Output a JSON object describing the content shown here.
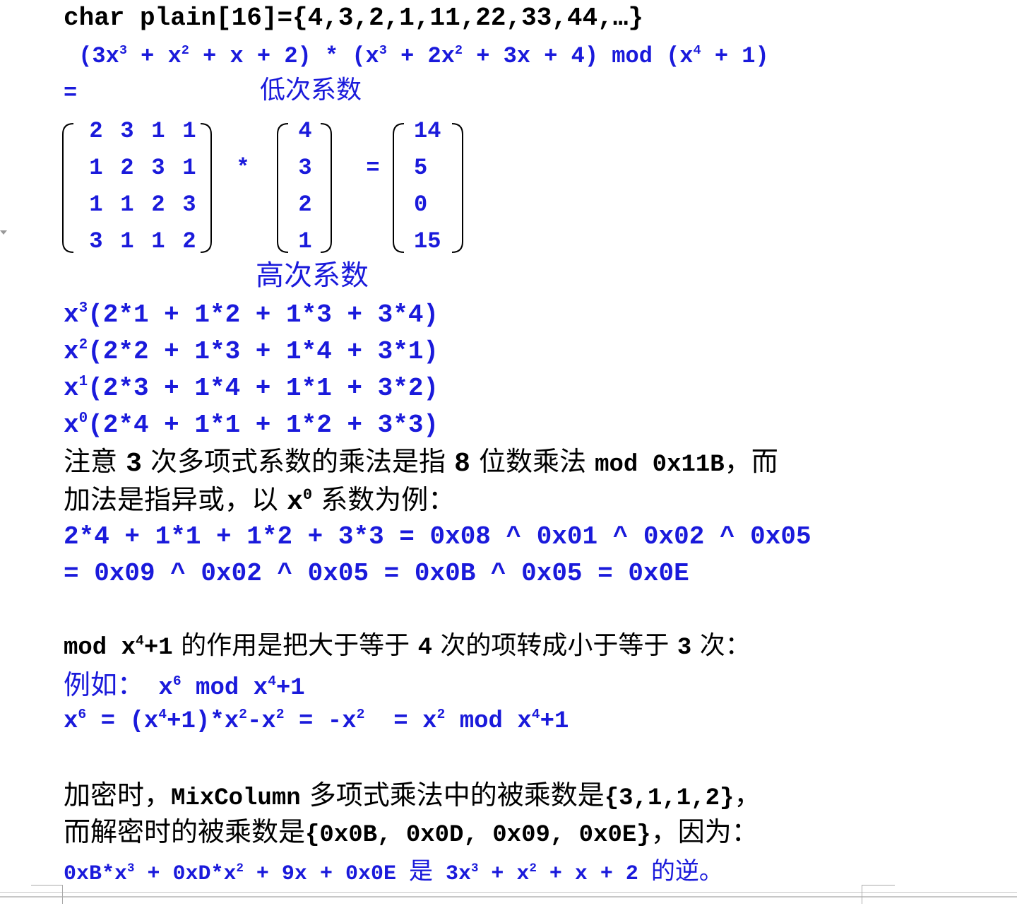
{
  "line1": "char plain[16]={4,3,2,1,11,22,33,44,…}",
  "line2": {
    "p1": " (3x",
    "e1": "3",
    "p2": " + x",
    "e2": "2",
    "p3": " + x + 2) * (x",
    "e3": "3",
    "p4": " + 2x",
    "e4": "2",
    "p5": " + 3x + 4) mod (x",
    "e5": "4",
    "p6": " + 1)"
  },
  "eq_sign": "=",
  "low_coeff_label": "低次系数",
  "high_coeff_label": "高次系数",
  "matrix": {
    "rows": [
      [
        "2",
        "3",
        "1",
        "1"
      ],
      [
        "1",
        "2",
        "3",
        "1"
      ],
      [
        "1",
        "1",
        "2",
        "3"
      ],
      [
        "3",
        "1",
        "1",
        "2"
      ]
    ],
    "times": "*",
    "vector": [
      "4",
      "3",
      "2",
      "1"
    ],
    "equals": "=",
    "result": [
      "14",
      "5",
      "0",
      "15"
    ]
  },
  "terms": [
    {
      "base": "x",
      "exp": "3",
      "expr": "(2*1 + 1*2 + 1*3 + 3*4)"
    },
    {
      "base": "x",
      "exp": "2",
      "expr": "(2*2 + 1*3 + 1*4 + 3*1)"
    },
    {
      "base": "x",
      "exp": "1",
      "expr": "(2*3 + 1*4 + 1*1 + 3*2)"
    },
    {
      "base": "x",
      "exp": "0",
      "expr": "(2*4 + 1*1 + 1*2 + 3*3)"
    }
  ],
  "note1": {
    "a": "注意 ",
    "b": "3",
    "c": " 次多项式系数的乘法是指 ",
    "d": "8",
    "e": " 位数乘法 ",
    "f": "mod 0x11B",
    "g": "，而"
  },
  "note2": {
    "a": "加法是指异或，以 ",
    "b": "x",
    "e": "0",
    "c": " 系数为例："
  },
  "calc1": "2*4 + 1*1 + 1*2 + 3*3 = 0x08 ^ 0x01 ^ 0x02 ^ 0x05",
  "calc2": "= 0x09 ^ 0x02 ^ 0x05 = 0x0B ^ 0x05 = 0x0E",
  "mod_note": {
    "a": "mod x",
    "e": "4",
    "b": "+1",
    "c": " 的作用是把大于等于 ",
    "d": "4",
    "f": " 次的项转成小于等于 ",
    "g": "3",
    "h": " 次："
  },
  "example_title": {
    "a": "例如：",
    "b": " x",
    "e": "6",
    "c": " mod x",
    "e2": "4",
    "d": "+1"
  },
  "example_eq": {
    "a": "x",
    "e1": "6",
    "b": " = (x",
    "e2": "4",
    "c": "+1)*x",
    "e3": "2",
    "d": "-x",
    "e4": "2",
    "f": " = -x",
    "e5": "2",
    "g": "  = x",
    "e6": "2",
    "h": " mod x",
    "e7": "4",
    "i": "+1"
  },
  "enc_note": {
    "a": "加密时，",
    "b": "MixColumn",
    "c": " 多项式乘法中的被乘数是",
    "d": "{3,1,1,2}",
    "e": "，"
  },
  "dec_note": {
    "a": "而解密时的被乘数是",
    "b": "{0x0B, 0x0D, 0x09, 0x0E}",
    "c": "，因为："
  },
  "inverse": {
    "a": "0xB*x",
    "e1": "3",
    "b": " + 0xD*x",
    "e2": "2",
    "c": " + 9x + 0x0E ",
    "d": "是",
    "f": " 3x",
    "e3": "3",
    "g": " + x",
    "e4": "2",
    "h": " + x + 2 ",
    "i": "的逆。"
  }
}
